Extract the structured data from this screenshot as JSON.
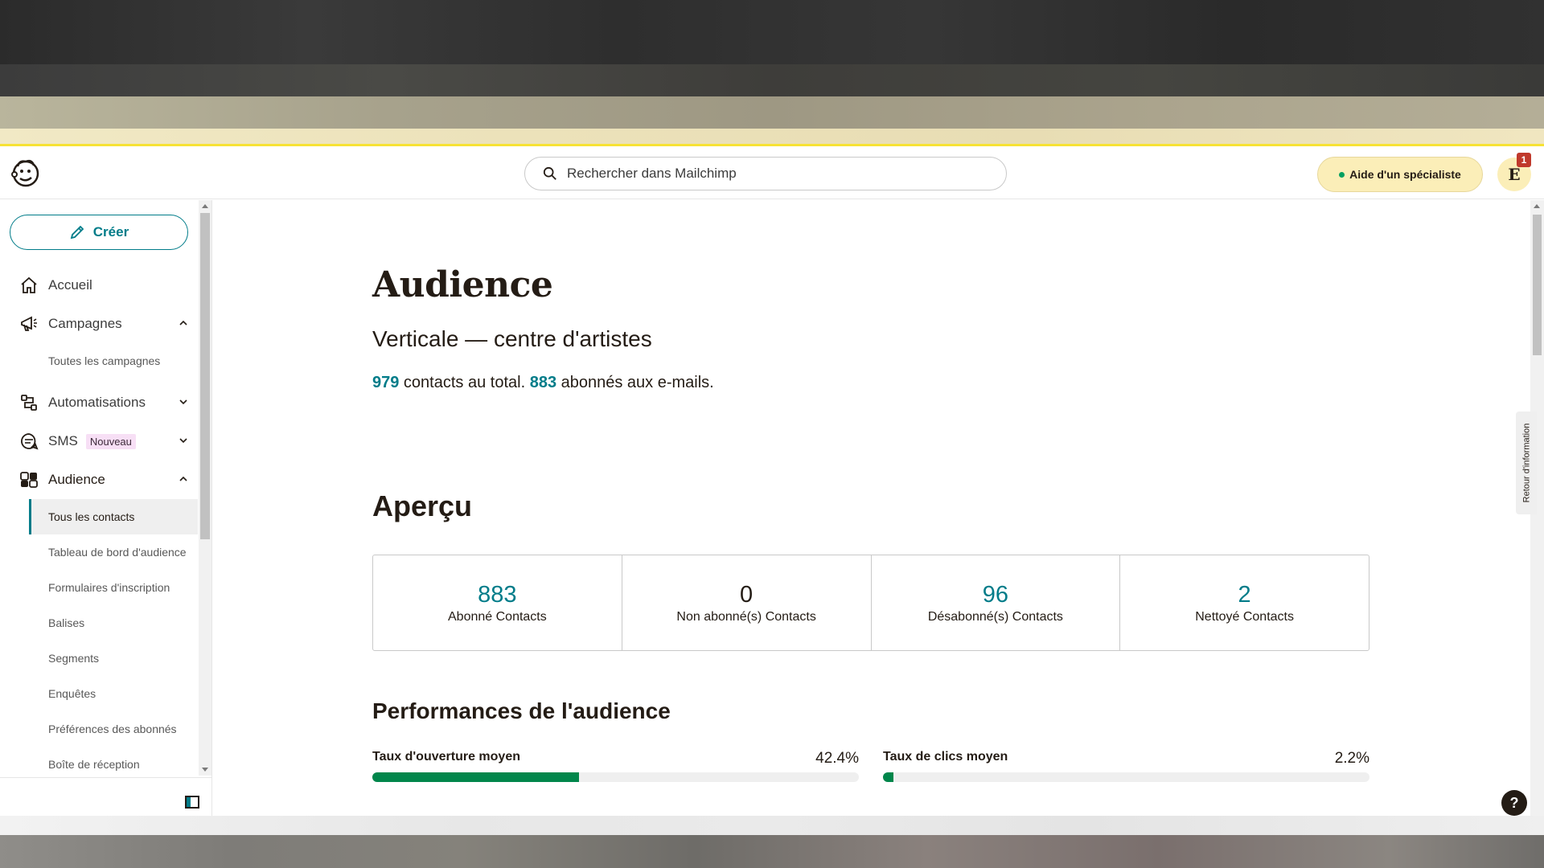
{
  "header": {
    "search_placeholder": "Rechercher dans Mailchimp",
    "help_button": "Aide d'un spécialiste",
    "avatar_letter": "E",
    "notification_count": "1"
  },
  "sidebar": {
    "create_label": "Créer",
    "items": [
      {
        "label": "Accueil",
        "icon": "home-icon"
      },
      {
        "label": "Campagnes",
        "icon": "megaphone-icon",
        "expanded": true
      },
      {
        "label": "Toutes les campagnes",
        "sub": true
      },
      {
        "label": "Automatisations",
        "icon": "automation-icon",
        "expanded": false
      },
      {
        "label": "SMS",
        "icon": "sms-icon",
        "tag": "Nouveau",
        "expanded": false
      },
      {
        "label": "Audience",
        "icon": "audience-icon",
        "expanded": true
      },
      {
        "label": "Tous les contacts",
        "sub": true,
        "current": true
      },
      {
        "label": "Tableau de bord d'audience",
        "sub": true
      },
      {
        "label": "Formulaires d'inscription",
        "sub": true
      },
      {
        "label": "Balises",
        "sub": true
      },
      {
        "label": "Segments",
        "sub": true
      },
      {
        "label": "Enquêtes",
        "sub": true
      },
      {
        "label": "Préférences des abonnés",
        "sub": true
      },
      {
        "label": "Boîte de réception",
        "sub": true
      }
    ]
  },
  "main": {
    "title": "Audience",
    "audience_name": "Verticale — centre d'artistes",
    "totals": {
      "contacts": "979",
      "contacts_text": " contacts au total. ",
      "subscribers": "883",
      "subscribers_text": " abonnés aux e-mails."
    },
    "overview_title": "Aperçu",
    "stats": [
      {
        "value": "883",
        "label": "Abonné Contacts"
      },
      {
        "value": "0",
        "label": "Non abonné(s) Contacts"
      },
      {
        "value": "96",
        "label": "Désabonné(s) Contacts"
      },
      {
        "value": "2",
        "label": "Nettoyé Contacts"
      }
    ],
    "performance_title": "Performances de l'audience",
    "metrics": [
      {
        "label": "Taux d'ouverture moyen",
        "value": "42.4%",
        "percent": 42.4
      },
      {
        "label": "Taux de clics moyen",
        "value": "2.2%",
        "percent": 2.2
      }
    ]
  },
  "feedback_tab": "Retour d'information",
  "help_icon": "?",
  "colors": {
    "accent": "#007c89",
    "progress": "#00864b",
    "highlight": "#fbeeb8"
  }
}
